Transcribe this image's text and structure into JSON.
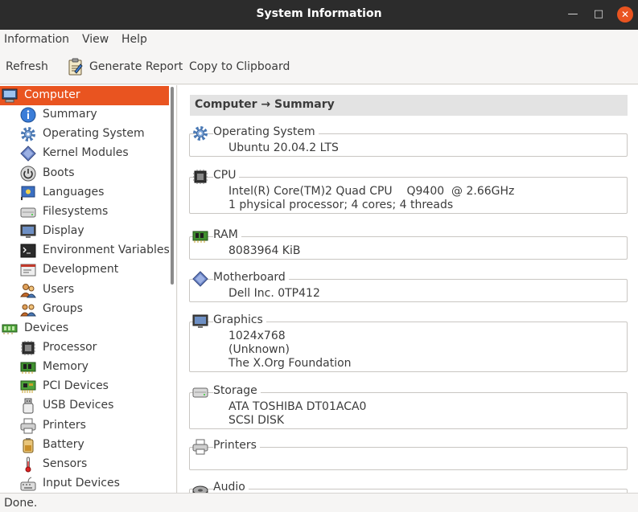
{
  "window": {
    "title": "System Information",
    "minimize": "—",
    "maximize": "□",
    "close": "✕"
  },
  "menu": [
    "Information",
    "View",
    "Help"
  ],
  "toolbar": {
    "refresh": "Refresh",
    "generate_report": "Generate Report",
    "copy": "Copy to Clipboard"
  },
  "sidebar": {
    "items": [
      {
        "label": "Computer",
        "icon": "computer-icon",
        "level": 0,
        "selected": true
      },
      {
        "label": "Summary",
        "icon": "info-icon",
        "level": 1
      },
      {
        "label": "Operating System",
        "icon": "gear-icon",
        "level": 1
      },
      {
        "label": "Kernel Modules",
        "icon": "module-icon",
        "level": 1
      },
      {
        "label": "Boots",
        "icon": "power-icon",
        "level": 1
      },
      {
        "label": "Languages",
        "icon": "flag-icon",
        "level": 1
      },
      {
        "label": "Filesystems",
        "icon": "disk-icon",
        "level": 1
      },
      {
        "label": "Display",
        "icon": "monitor-icon",
        "level": 1
      },
      {
        "label": "Environment Variables",
        "icon": "terminal-icon",
        "level": 1
      },
      {
        "label": "Development",
        "icon": "development-icon",
        "level": 1
      },
      {
        "label": "Users",
        "icon": "users-icon",
        "level": 1
      },
      {
        "label": "Groups",
        "icon": "groups-icon",
        "level": 1
      },
      {
        "label": "Devices",
        "icon": "devices-icon",
        "level": 0
      },
      {
        "label": "Processor",
        "icon": "processor-icon",
        "level": 1
      },
      {
        "label": "Memory",
        "icon": "memory-icon",
        "level": 1
      },
      {
        "label": "PCI Devices",
        "icon": "pci-icon",
        "level": 1
      },
      {
        "label": "USB Devices",
        "icon": "usb-icon",
        "level": 1
      },
      {
        "label": "Printers",
        "icon": "printer-icon",
        "level": 1
      },
      {
        "label": "Battery",
        "icon": "battery-icon",
        "level": 1
      },
      {
        "label": "Sensors",
        "icon": "thermometer-icon",
        "level": 1
      },
      {
        "label": "Input Devices",
        "icon": "input-device-icon",
        "level": 1
      }
    ]
  },
  "content": {
    "header": "Computer → Summary",
    "groups": [
      {
        "title": "Operating System",
        "icon": "gear-icon",
        "lines": [
          "Ubuntu 20.04.2 LTS"
        ]
      },
      {
        "title": "CPU",
        "icon": "processor-icon",
        "lines": [
          "Intel(R) Core(TM)2 Quad CPU    Q9400  @ 2.66GHz",
          "1 physical processor; 4 cores; 4 threads"
        ]
      },
      {
        "title": "RAM",
        "icon": "memory-icon",
        "lines": [
          "8083964 KiB"
        ]
      },
      {
        "title": "Motherboard",
        "icon": "module-icon",
        "lines": [
          "Dell Inc. 0TP412"
        ]
      },
      {
        "title": "Graphics",
        "icon": "monitor-icon",
        "lines": [
          "1024x768",
          "(Unknown)",
          "The X.Org Foundation"
        ]
      },
      {
        "title": "Storage",
        "icon": "disk-icon",
        "lines": [
          "ATA TOSHIBA DT01ACA0",
          "SCSI DISK"
        ]
      },
      {
        "title": "Printers",
        "icon": "printer-icon",
        "lines": []
      },
      {
        "title": "Audio",
        "icon": "audio-icon",
        "lines": []
      }
    ]
  },
  "status": "Done.",
  "colors": {
    "accent": "#e95420",
    "titlebar": "#2c2c2c",
    "header_bg": "#e3e3e3"
  }
}
